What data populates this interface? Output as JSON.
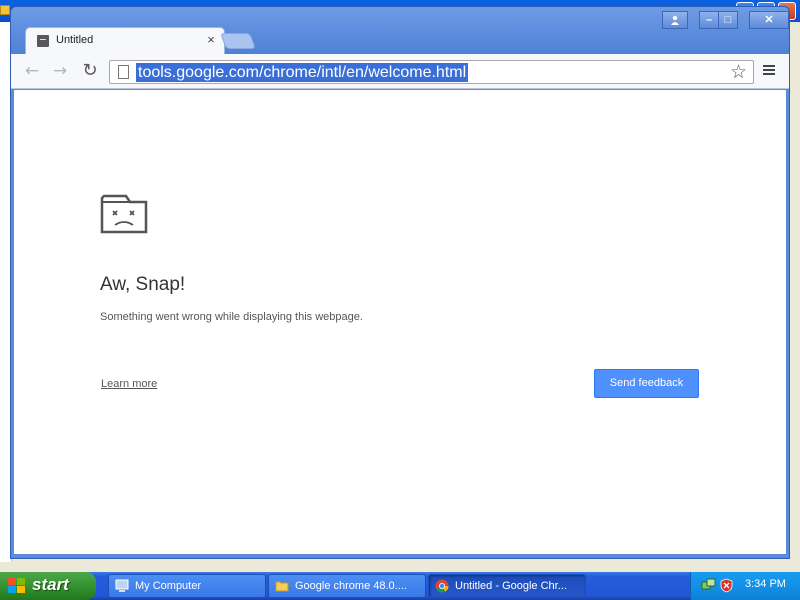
{
  "browser": {
    "tab": {
      "title": "Untitled",
      "close_glyph": "×",
      "favicon": "sad-page-icon"
    },
    "toolbar": {
      "back_glyph": "←",
      "forward_glyph": "→",
      "reload_glyph": "↻",
      "url": "tools.google.com/chrome/intl/en/welcome.html",
      "star_glyph": "☆",
      "url_selected": true
    },
    "window_controls": {
      "user_glyph": "👤",
      "min_glyph": "–",
      "max_glyph": "□",
      "close_glyph": "✕"
    }
  },
  "page": {
    "icon": "sad-folder-icon",
    "title": "Aw, Snap!",
    "description": "Something went wrong while displaying this webpage.",
    "learn_more": "Learn more",
    "feedback_button": "Send feedback"
  },
  "taskbar": {
    "start_label": "start",
    "items": [
      {
        "label": "My Computer",
        "icon": "computer-icon"
      },
      {
        "label": "Google chrome 48.0....",
        "icon": "folder-icon"
      },
      {
        "label": "Untitled - Google Chr...",
        "icon": "chrome-icon"
      }
    ],
    "clock": "3:34 PM"
  },
  "colors": {
    "feedback_blue": "#4d90fe",
    "url_selection": "#3a6fd8",
    "chrome_frame": "#5b8bdc",
    "taskbar_blue": "#245ddb",
    "start_green": "#2f8e2b"
  }
}
